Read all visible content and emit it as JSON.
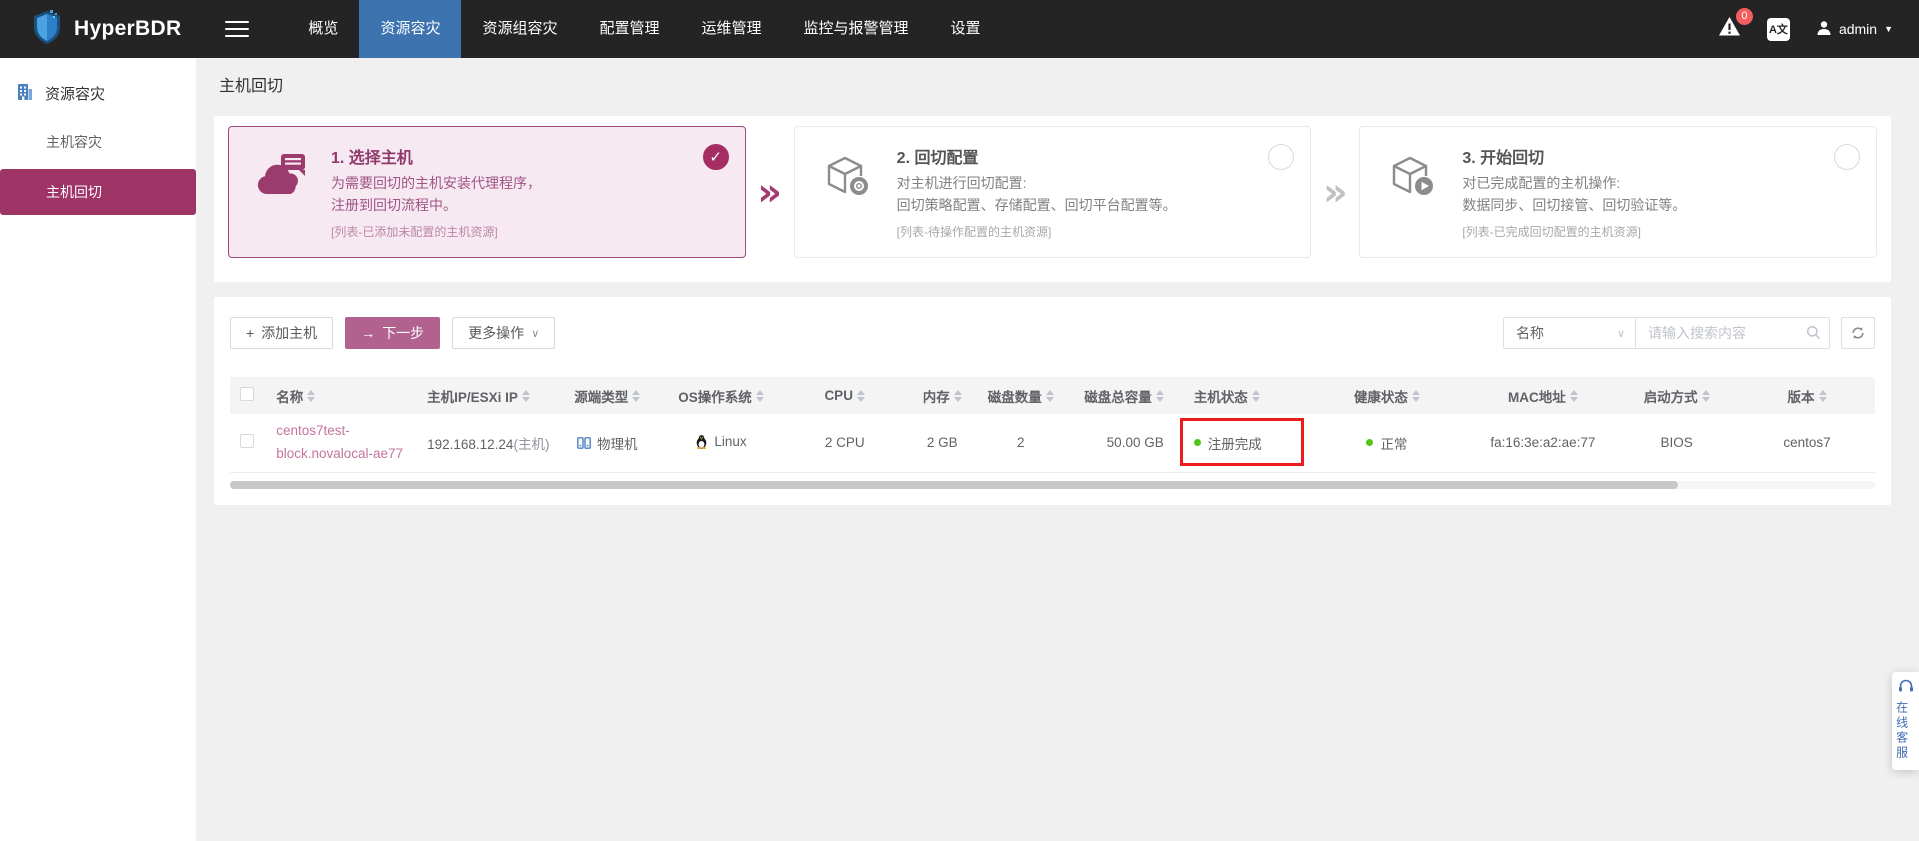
{
  "navbar": {
    "brand": "HyperBDR",
    "items": [
      {
        "label": "概览"
      },
      {
        "label": "资源容灾"
      },
      {
        "label": "资源组容灾"
      },
      {
        "label": "配置管理"
      },
      {
        "label": "运维管理"
      },
      {
        "label": "监控与报警管理"
      },
      {
        "label": "设置"
      }
    ],
    "notification_count": "0",
    "language_icon_label": "A文",
    "username": "admin"
  },
  "sidebar": {
    "section_title": "资源容灾",
    "items": [
      {
        "label": "主机容灾"
      },
      {
        "label": "主机回切"
      }
    ]
  },
  "page": {
    "title": "主机回切"
  },
  "steps": [
    {
      "title": "1. 选择主机",
      "line1": "为需要回切的主机安装代理程序，",
      "line2": "注册到回切流程中。",
      "note": "[列表-已添加未配置的主机资源]",
      "state": "done"
    },
    {
      "title": "2. 回切配置",
      "line1": "对主机进行回切配置:",
      "line2": "回切策略配置、存储配置、回切平台配置等。",
      "note": "[列表-待操作配置的主机资源]",
      "state": "pending"
    },
    {
      "title": "3. 开始回切",
      "line1": "对已完成配置的主机操作:",
      "line2": "数据同步、回切接管、回切验证等。",
      "note": "[列表-已完成回切配置的主机资源]",
      "state": "pending"
    }
  ],
  "toolbar": {
    "add_host": "添加主机",
    "next_step": "下一步",
    "more_actions": "更多操作",
    "filter_field": "名称",
    "search_placeholder": "请输入搜索内容"
  },
  "table": {
    "columns": [
      "名称",
      "主机IP/ESXi IP",
      "源端类型",
      "OS操作系统",
      "CPU",
      "内存",
      "磁盘数量",
      "磁盘总容量",
      "主机状态",
      "健康状态",
      "MAC地址",
      "启动方式",
      "版本"
    ],
    "row": {
      "name_line1": "centos7test-",
      "name_line2": "block.novalocal-ae77",
      "ip": "192.168.12.24",
      "ip_suffix": "(主机)",
      "source_type": "物理机",
      "os": "Linux",
      "cpu": "2 CPU",
      "memory": "2 GB",
      "disk_count": "2",
      "disk_total": "50.00 GB",
      "host_status": "注册完成",
      "health_status": "正常",
      "mac": "fa:16:3e:a2:ae:77",
      "boot_type": "BIOS",
      "version": "centos7"
    }
  },
  "floating": {
    "online_service": "在线客服"
  },
  "colors": {
    "accent": "#9e3366",
    "nav_active": "#3d74b0",
    "primary_button": "#b2628e",
    "status_ok": "#52c41a",
    "annotation_box": "#ec1c1c"
  }
}
